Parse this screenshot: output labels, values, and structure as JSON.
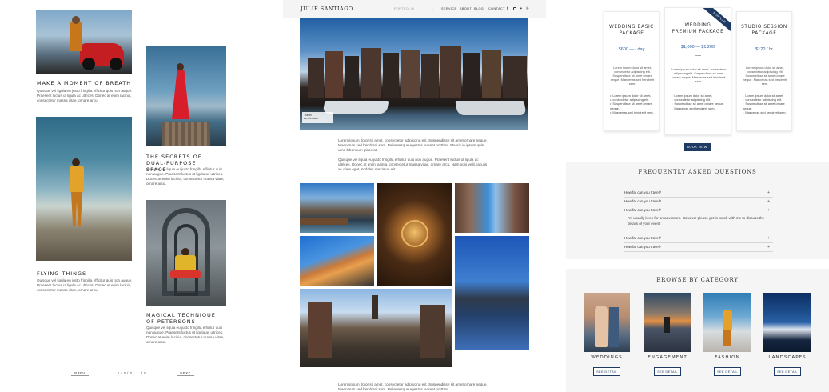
{
  "portfolio": {
    "items": [
      {
        "title": "MAKE A MOMENT OF BREATH",
        "body": "Quisque vel ligula eu justo fringilla efficitur quis non augue. Praesent luctus ut ligula ac ultrices. Donec at enim lacinia, consectetur massa vitae, ornare arcu."
      },
      {
        "title": "THE SECRETS OF DUAL-PURPOSE SPACE",
        "body": "Quisque vel ligula eu justo fringilla efficitur quis non augue. Praesent luctus ut ligula ac ultrices. Donec at enim lacinia, consectetur massa vitae, ornare arcu."
      },
      {
        "title": "FLYING THINGS",
        "body": "Quisque vel ligula eu justo fringilla efficitur quis non augue. Praesent luctus ut ligula ac ultrices. Donec at enim lacinia, consectetur massa vitae, ornare arcu."
      },
      {
        "title": "MAGICAL TECHNIQUE OF PETERSONS",
        "body": "Quisque vel ligula eu justo fringilla efficitur quis non augue. Praesent luctus ut ligula ac ultrices. Donec at enim lacinia, consectetur massa vitae, ornare arcu."
      }
    ],
    "pagination": {
      "prev": "PREV",
      "pages": "1 / 2 / 3 / ... / 8",
      "next": "NEXT"
    }
  },
  "blog": {
    "logo": "JULIE SANTIAGO",
    "nav": [
      "PORTFOLIO",
      "SERVICE",
      "ABOUT",
      "BLOG",
      "CONTACT"
    ],
    "hero_caption": [
      "Travel",
      "Amsterdam"
    ],
    "para1": "Lorem ipsum dolor sit amet, consectetur adipiscing elit. Suspendisse sit amet ornare neque. Maecenas sed hendrerit sem. Pellentesque egestas laoreet porttitor. Mauris in ipsum quis urna bibendum placerat.",
    "para2": "Quisque vel ligula eu justo fringilla efficitur quis non augue. Praesent luctus ut ligula ac ultrices. Donec at enim lacinia, consectetur massa vitae, ornare arcu. Nam odio velit, iaculis ac diam eget, sodales maximus elit.",
    "para3": "Lorem ipsum dolor sit amet, consectetur adipiscing elit. Suspendisse sit amet ornare neque. Maecenas sed hendrerit sem. Pellentesque egestas laoreet porttitor."
  },
  "pricing": {
    "cards": [
      {
        "title": "WEDDING BASIC PACKAGE",
        "price": "$600 — / day",
        "text": "Lorem ipsum dolor sit amet, consectetur adipiscing elit. Suspendisse sit amet ornare neque. Maecenas sed hendrerit sem.",
        "features": [
          "Lorem ipsum dolor sit amet,",
          "consectetur adipiscing elit.",
          "Suspendisse sit amet ornare neque.",
          "Maecenas sed hendrerit sem."
        ]
      },
      {
        "title": "WEDDING PREMIUM PACKAGE",
        "price": "$1,000 — $1,200",
        "badge": "POPULAR",
        "text": "Lorem ipsum dolor sit amet, consectetur adipiscing elit. Suspendisse sit amet ornare neque. Maecenas sed hendrerit sem.",
        "features": [
          "Lorem ipsum dolor sit amet,",
          "consectetur adipiscing elit.",
          "Suspendisse sit amet ornare neque.",
          "Maecenas sed hendrerit sem."
        ]
      },
      {
        "title": "STUDIO SESSION PACKAGE",
        "price": "$120 / hr",
        "text": "Lorem ipsum dolor sit amet, consectetur adipiscing elit. Suspendisse sit amet ornare neque. Maecenas sed hendrerit sem.",
        "features": [
          "Lorem ipsum dolor sit amet,",
          "consectetur adipiscing elit.",
          "Suspendisse sit amet ornare neque.",
          "Maecenas sed hendrerit sem."
        ]
      }
    ],
    "book_now": "BOOK NOW"
  },
  "faq": {
    "title": "FREQUENTLY ASKED QUESTIONS",
    "questions": [
      "How far can you travel?",
      "How far can you travel?",
      "How far can you travel?",
      "How far can you travel?",
      "How far can you travel?"
    ],
    "answer": "I'm usually keen for an adventure. However please get in touch with me to discuss the details of your event."
  },
  "categories": {
    "title": "BROWSE BY CATEGORY",
    "items": [
      "WEDDINGS",
      "ENGAGEMENT",
      "FASHION",
      "LANDSCAPES"
    ],
    "button": "SEE DETAIL"
  }
}
